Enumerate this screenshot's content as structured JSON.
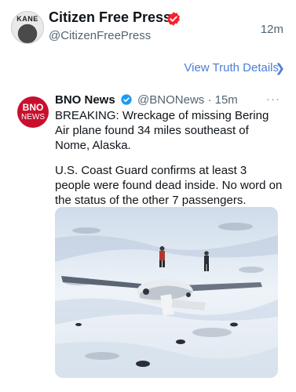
{
  "post": {
    "author_name": "Citizen Free Press",
    "author_handle": "@CitizenFreePress",
    "time": "12m",
    "avatar_text": "KANE",
    "view_details": "View Truth Details"
  },
  "embedded": {
    "avatar_line1": "BNO",
    "avatar_line2": "NEWS",
    "name": "BNO News",
    "handle_time": "@BNONews · 15m",
    "text1": "BREAKING: Wreckage of missing Bering Air plane found 34 miles southeast of Nome, Alaska.",
    "text2": "U.S. Coast Guard confirms at least 3 people were found dead inside. No word on the status of the other 7 passengers.",
    "more": "···"
  },
  "icons": {
    "verified_color": "#f4212e",
    "embed_verified_color": "#1d9bf0",
    "link_color": "#4a7fd8"
  }
}
